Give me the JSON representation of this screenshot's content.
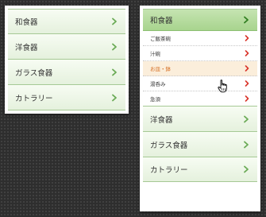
{
  "colors": {
    "background": "#2e2e2e",
    "item_gradient_light": "#f7fcf3",
    "item_gradient_dark": "#e5f1dd",
    "active_gradient_light": "#c5e4b1",
    "active_gradient_dark": "#a8d48e",
    "divider": "#a6c995",
    "chevron_green": "#6aaa55",
    "chevron_dark_green": "#2f7d1f",
    "chevron_red": "#d9352b",
    "hover_background": "#fbeedb",
    "hover_text": "#d46a1d"
  },
  "left_menu": {
    "items": [
      {
        "label": "和食器",
        "icon": "chevron-right-icon"
      },
      {
        "label": "洋食器",
        "icon": "chevron-right-icon"
      },
      {
        "label": "ガラス食器",
        "icon": "chevron-right-icon"
      },
      {
        "label": "カトラリー",
        "icon": "chevron-right-icon"
      }
    ]
  },
  "right_menu": {
    "expanded_item": {
      "label": "和食器",
      "icon": "chevron-right-icon"
    },
    "submenu": [
      {
        "label": "ご飯茶碗",
        "icon": "chevron-right-icon"
      },
      {
        "label": "汁碗",
        "icon": "chevron-right-icon"
      },
      {
        "label": "お皿・鉢",
        "icon": "chevron-right-icon",
        "state": "hover"
      },
      {
        "label": "湯呑み",
        "icon": "chevron-right-icon"
      },
      {
        "label": "急須",
        "icon": "chevron-right-icon"
      }
    ],
    "items": [
      {
        "label": "洋食器",
        "icon": "chevron-right-icon"
      },
      {
        "label": "ガラス食器",
        "icon": "chevron-right-icon"
      },
      {
        "label": "カトラリー",
        "icon": "chevron-right-icon"
      }
    ]
  },
  "cursor": {
    "icon": "hand-pointer-icon"
  }
}
